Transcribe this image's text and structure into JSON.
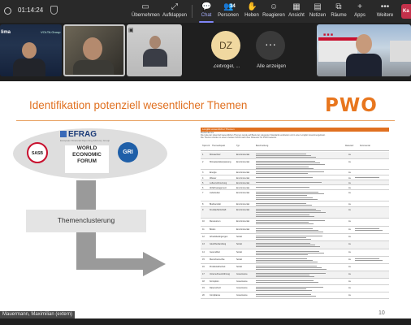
{
  "top_bar": {
    "timer": "01:14:24",
    "participant_count": "34",
    "tools": [
      {
        "name": "uebernehmen",
        "label": "Übernehmen",
        "icon": "take-control-icon"
      },
      {
        "name": "aufklappen",
        "label": "Aufklappen",
        "icon": "expand-icon"
      },
      {
        "name": "chat",
        "label": "Chat",
        "icon": "chat-icon"
      },
      {
        "name": "personen",
        "label": "Personen",
        "icon": "people-icon"
      },
      {
        "name": "heben",
        "label": "Heben",
        "icon": "raise-hand-icon"
      },
      {
        "name": "reagieren",
        "label": "Reagieren",
        "icon": "react-icon"
      },
      {
        "name": "ansicht",
        "label": "Ansicht",
        "icon": "view-icon"
      },
      {
        "name": "notizen",
        "label": "Notizen",
        "icon": "notes-icon"
      },
      {
        "name": "raeume",
        "label": "Räume",
        "icon": "rooms-icon"
      },
      {
        "name": "apps",
        "label": "Apps",
        "icon": "apps-icon"
      },
      {
        "name": "weitere",
        "label": "Weitere",
        "icon": "more-icon"
      }
    ],
    "active_tool": "Chat",
    "leave_label": "Ka"
  },
  "participants": {
    "avatar_initials": "DZ",
    "avatar_name": "Zeitvogel, ...",
    "show_all_label": "Alle anzeigen",
    "tile1_logo_left": "lima",
    "tile1_logo_right": "VOLTA Group"
  },
  "slide": {
    "title": "Identifikation potenziell wesentlicher Themen",
    "brand_logo": "PWO",
    "efrag_logo": "EFRAG",
    "efrag_subtitle": "European Financial Reporting Advisory Group",
    "sasb_logo": "SASB",
    "wef_logo_lines": [
      "WORLD",
      "ECONOMIC",
      "FORUM"
    ],
    "gri_logo": "GRI",
    "cluster_label": "Themenclusterung",
    "page_number": "10",
    "table": {
      "header": "Longlist wesentlicher Themen",
      "meta_lines": [
        "Mediendienste",
        "Die Liste der potenziell wesentlichen Themen wurde auf Basis der relevanten Standards erarbeitet und in einer Longlist zusammengefasst.",
        "Die Themen wurden in einem zweiten Schritt nach ihrer Relevanz für PWO bewertet."
      ],
      "columns": [
        "Topic-Nr.",
        "Thema/Aspekt",
        "Typ",
        "Beschreibung",
        "Relevanz",
        "Kommentar"
      ],
      "rows": [
        {
          "num": "1",
          "topic": "Klimaschutz",
          "type": "Environmental",
          "rel": "Ja"
        },
        {
          "num": "2",
          "topic": "Klimawandelanpassung",
          "type": "Environmental",
          "rel": "Ja"
        },
        {
          "num": "3",
          "topic": "Energie",
          "type": "Environmental",
          "rel": "Ja"
        },
        {
          "num": "4",
          "topic": "Wasser",
          "type": "Environmental",
          "rel": "Ja"
        },
        {
          "num": "5",
          "topic": "Luftverschmutzung",
          "type": "Environmental",
          "rel": "Ja"
        },
        {
          "num": "6",
          "topic": "Abfallmanagement",
          "type": "Environmental",
          "rel": "Ja"
        },
        {
          "num": "7",
          "topic": "Lieferketten",
          "type": "Environmental",
          "rel": "Ja"
        },
        {
          "num": "8",
          "topic": "Biodiversität",
          "type": "Environmental",
          "rel": "Ja"
        },
        {
          "num": "9",
          "topic": "Kreislaufwirtschaft",
          "type": "Environmental",
          "rel": "Ja"
        },
        {
          "num": "10",
          "topic": "Ressourcen",
          "type": "Environmental",
          "rel": "Ja"
        },
        {
          "num": "11",
          "topic": "Boden",
          "type": "Environmental",
          "rel": "Ja"
        },
        {
          "num": "12",
          "topic": "Arbeitsbedingungen",
          "type": "Social",
          "rel": "Ja"
        },
        {
          "num": "13",
          "topic": "Gleichbehandlung",
          "type": "Social",
          "rel": "Ja"
        },
        {
          "num": "14",
          "topic": "Gesundheit",
          "type": "Social",
          "rel": "Ja"
        },
        {
          "num": "15",
          "topic": "Menschenrechte",
          "type": "Social",
          "rel": "Ja"
        },
        {
          "num": "16",
          "topic": "Produktsicherheit",
          "type": "Social",
          "rel": "Ja"
        },
        {
          "num": "17",
          "topic": "Unternehmensführung",
          "type": "Governance",
          "rel": "Ja"
        },
        {
          "num": "18",
          "topic": "Korruption",
          "type": "Governance",
          "rel": "Ja"
        },
        {
          "num": "19",
          "topic": "Datenschutz",
          "type": "Governance",
          "rel": "Ja"
        },
        {
          "num": "20",
          "topic": "Compliance",
          "type": "Governance",
          "rel": "Ja"
        }
      ]
    }
  },
  "presenter_name": "Mauermann, Maximilian (extern)",
  "colors": {
    "accent": "#e07020",
    "teams_purple": "#7f85f5",
    "leave_red": "#c4314b"
  }
}
